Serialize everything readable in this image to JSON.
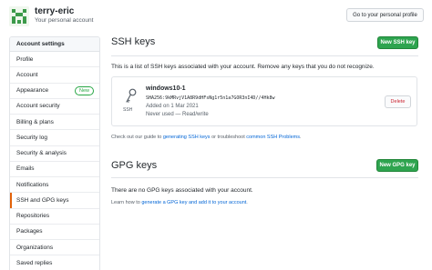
{
  "header": {
    "username": "terry-eric",
    "subtitle": "Your personal account",
    "profile_button": "Go to your personal profile"
  },
  "sidebar": {
    "heading": "Account settings",
    "items": [
      {
        "label": "Profile"
      },
      {
        "label": "Account"
      },
      {
        "label": "Appearance",
        "badge": "New"
      },
      {
        "label": "Account security"
      },
      {
        "label": "Billing & plans"
      },
      {
        "label": "Security log"
      },
      {
        "label": "Security & analysis"
      },
      {
        "label": "Emails"
      },
      {
        "label": "Notifications"
      },
      {
        "label": "SSH and GPG keys",
        "active": true
      },
      {
        "label": "Repositories"
      },
      {
        "label": "Packages"
      },
      {
        "label": "Organizations"
      },
      {
        "label": "Saved replies"
      }
    ]
  },
  "ssh": {
    "title": "SSH keys",
    "new_button": "New SSH key",
    "description": "This is a list of SSH keys associated with your account. Remove any keys that you do not recognize.",
    "keys": [
      {
        "type_label": "SSH",
        "title": "windows10-1",
        "fingerprint": "SHA256:9kMRvjV1A8R9dHFsNg1r5n1a7GOR3nI4D//4Hk8w",
        "added": "Added on 1 Mar 2021",
        "last_used": "Never used — Read/write",
        "delete_label": "Delete"
      }
    ],
    "guide_prefix": "Check out our guide to ",
    "guide_link1": "generating SSH keys",
    "guide_middle": " or troubleshoot ",
    "guide_link2": "common SSH Problems",
    "guide_suffix": "."
  },
  "gpg": {
    "title": "GPG keys",
    "new_button": "New GPG key",
    "empty_text": "There are no GPG keys associated with your account.",
    "learn_prefix": "Learn how to ",
    "learn_link": "generate a GPG key and add it to your account",
    "learn_suffix": "."
  },
  "colors": {
    "accent_green": "#2ea44f",
    "link_blue": "#0366d6",
    "active_marker": "#e36209",
    "danger_red": "#cb2431"
  }
}
